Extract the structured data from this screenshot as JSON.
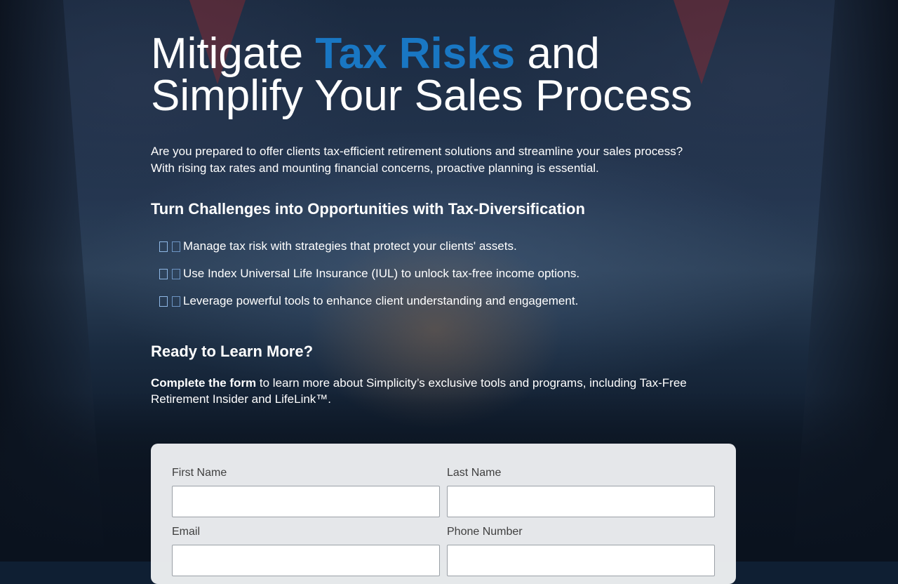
{
  "hero": {
    "title_pre": "Mitigate ",
    "title_accent": "Tax Risks",
    "title_post": " and",
    "title_line2": "Simplify Your Sales Process",
    "accent_color": "#1977c3"
  },
  "intro": {
    "line1": "Are you prepared to offer clients tax-efficient retirement solutions and streamline your sales process?",
    "line2": "With rising tax rates and mounting financial concerns, proactive planning is essential."
  },
  "section": {
    "heading": "Turn Challenges into Opportunities with Tax-Diversification",
    "benefits": [
      {
        "icon": "box-icon",
        "text": "Manage tax risk with strategies that protect your clients' assets."
      },
      {
        "icon": "box-icon",
        "text": "Use Index Universal Life Insurance (IUL) to unlock tax-free income options."
      },
      {
        "icon": "box-icon",
        "text": "Leverage powerful tools to enhance client understanding and engagement."
      }
    ]
  },
  "cta": {
    "heading": "Ready to Learn More?",
    "bold": "Complete the form",
    "text": " to learn more about Simplicity’s exclusive tools and programs, including Tax-Free Retirement Insider and LifeLink™."
  },
  "form": {
    "first_name_label": "First Name",
    "first_name_value": "",
    "last_name_label": "Last Name",
    "last_name_value": "",
    "email_label": "Email",
    "email_value": "",
    "phone_label": "Phone Number",
    "phone_value": ""
  }
}
